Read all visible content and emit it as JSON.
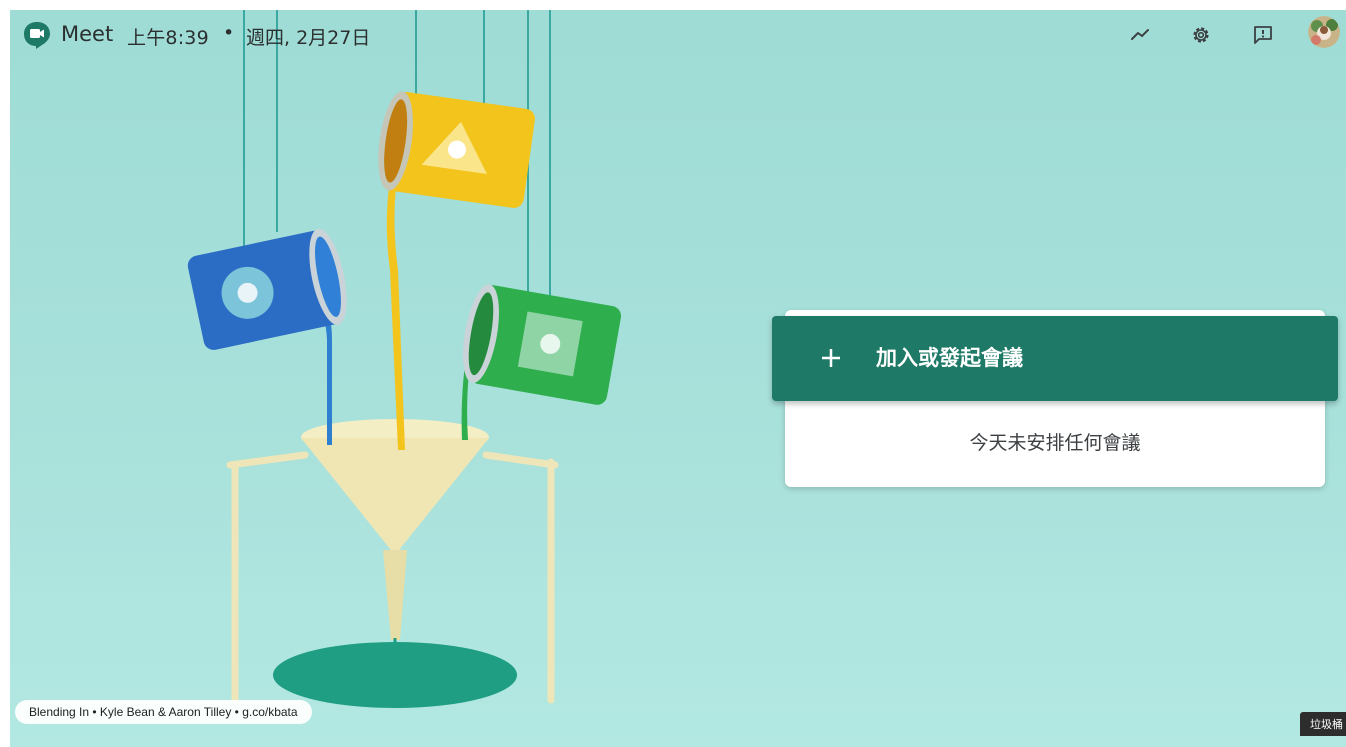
{
  "app": {
    "name": "Meet"
  },
  "header": {
    "time": "上午8:39",
    "separator": "•",
    "date": "週四, 2月27日",
    "icons": [
      "trending-icon",
      "gear-icon",
      "feedback-icon",
      "avatar"
    ]
  },
  "main": {
    "join_label": "加入或發起會議",
    "join_icon": "plus-icon",
    "empty_message": "今天未安排任何會議"
  },
  "footer": {
    "credit": "Blending In • Kyle Bean & Aaron Tilley • g.co/kbata"
  },
  "dock": {
    "trash_label": "垃圾桶"
  },
  "colors": {
    "accent": "#1e7a66",
    "background": "#a9e1db",
    "card": "#ffffff",
    "text": "#2b2f2f"
  }
}
